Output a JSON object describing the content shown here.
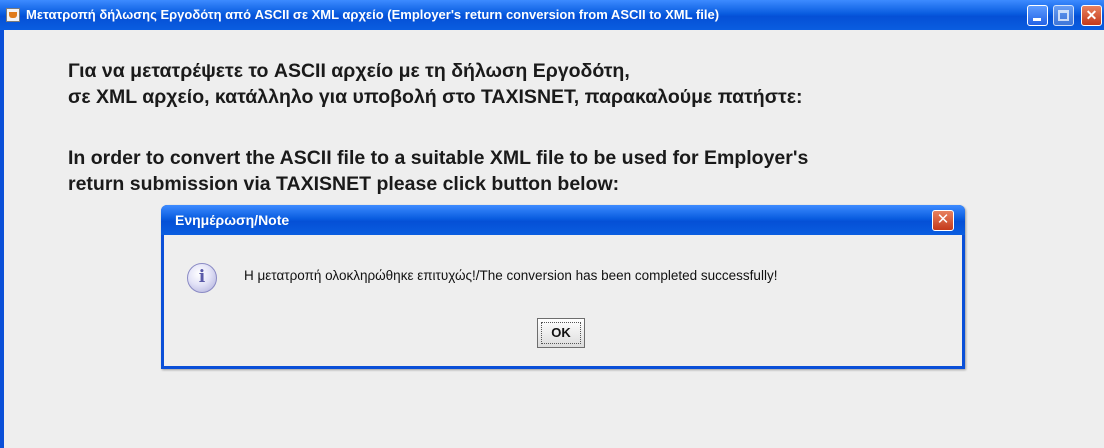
{
  "window": {
    "title": "Μετατροπή δήλωσης Εργοδότη από ASCII σε XML αρχείο (Employer's return conversion from ASCII to XML file)",
    "icon": "java-cup-icon",
    "controls": [
      "minimize",
      "maximize",
      "close"
    ]
  },
  "main": {
    "greek_line_1": "Για να μετατρέψετε το ASCII αρχείο με τη δήλωση Εργοδότη,",
    "greek_line_2": "σε XML αρχείο, κατάλληλο για υποβολή στο TAXISNET, παρακαλούμε πατήστε:",
    "english_line_1": "In order to convert the ASCII file to a suitable XML file to be used for Employer's",
    "english_line_2": "return submission via TAXISNET please click button below:"
  },
  "dialog": {
    "title": "Ενημέρωση/Note",
    "icon": "info-icon",
    "icon_glyph": "i",
    "message": "Η μετατροπή ολοκληρώθηκε επιτυχώς!/The conversion has been completed successfully!",
    "ok_label": "OK"
  },
  "colors": {
    "titlebar_blue": "#0a5de0",
    "close_red": "#c4391b",
    "background": "#eeeeee"
  }
}
